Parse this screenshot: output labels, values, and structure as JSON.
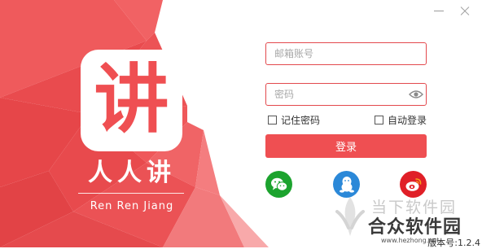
{
  "window": {
    "minimize_label": "minimize",
    "close_label": "close"
  },
  "brand": {
    "logo_char": "讲",
    "name": "人人讲",
    "pinyin": "Ren  Ren  Jiang",
    "primary_color": "#ef4f52"
  },
  "login_form": {
    "email_placeholder": "邮箱账号",
    "password_placeholder": "密码",
    "remember_password_label": "记住密码",
    "auto_login_label": "自动登录",
    "remember_password_checked": false,
    "auto_login_checked": false,
    "login_button_label": "登录"
  },
  "social_login": [
    {
      "name": "wechat",
      "icon": "wechat-icon",
      "color": "#1ca32e"
    },
    {
      "name": "qq",
      "icon": "qq-penguin-icon",
      "color": "#2b88d8"
    },
    {
      "name": "weibo",
      "icon": "weibo-icon",
      "color": "#e01f27"
    }
  ],
  "watermark": {
    "line1": "当下软件园",
    "line2": "合众软件园",
    "url": "www.hezhong.net"
  },
  "footer": {
    "version_text": "版本号:1.2.4"
  }
}
